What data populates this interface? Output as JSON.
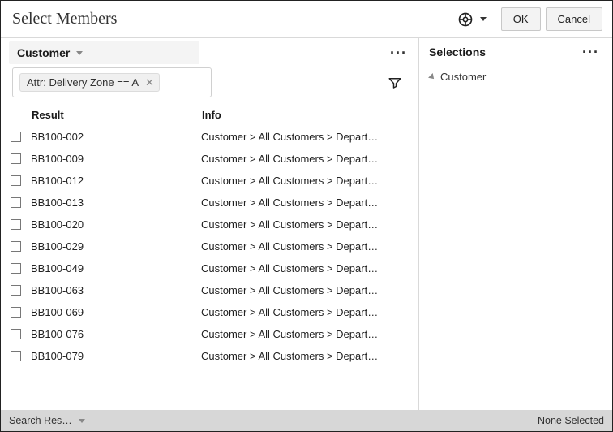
{
  "header": {
    "title": "Select Members",
    "ok_label": "OK",
    "cancel_label": "Cancel"
  },
  "dimension": {
    "label": "Customer"
  },
  "filter": {
    "chip_label": "Attr: Delivery Zone == A"
  },
  "columns": {
    "result": "Result",
    "info": "Info"
  },
  "rows": [
    {
      "name": "BB100-002",
      "info": "Customer > All Customers > Depart…"
    },
    {
      "name": "BB100-009",
      "info": "Customer > All Customers > Depart…"
    },
    {
      "name": "BB100-012",
      "info": "Customer > All Customers > Depart…"
    },
    {
      "name": "BB100-013",
      "info": "Customer > All Customers > Depart…"
    },
    {
      "name": "BB100-020",
      "info": "Customer > All Customers > Depart…"
    },
    {
      "name": "BB100-029",
      "info": "Customer > All Customers > Depart…"
    },
    {
      "name": "BB100-049",
      "info": "Customer > All Customers > Depart…"
    },
    {
      "name": "BB100-063",
      "info": "Customer > All Customers > Depart…"
    },
    {
      "name": "BB100-069",
      "info": "Customer > All Customers > Depart…"
    },
    {
      "name": "BB100-076",
      "info": "Customer > All Customers > Depart…"
    },
    {
      "name": "BB100-079",
      "info": "Customer > All Customers > Depart…"
    }
  ],
  "selections": {
    "title": "Selections",
    "root": "Customer"
  },
  "footer": {
    "left_label": "Search Res…",
    "right_label": "None Selected"
  }
}
